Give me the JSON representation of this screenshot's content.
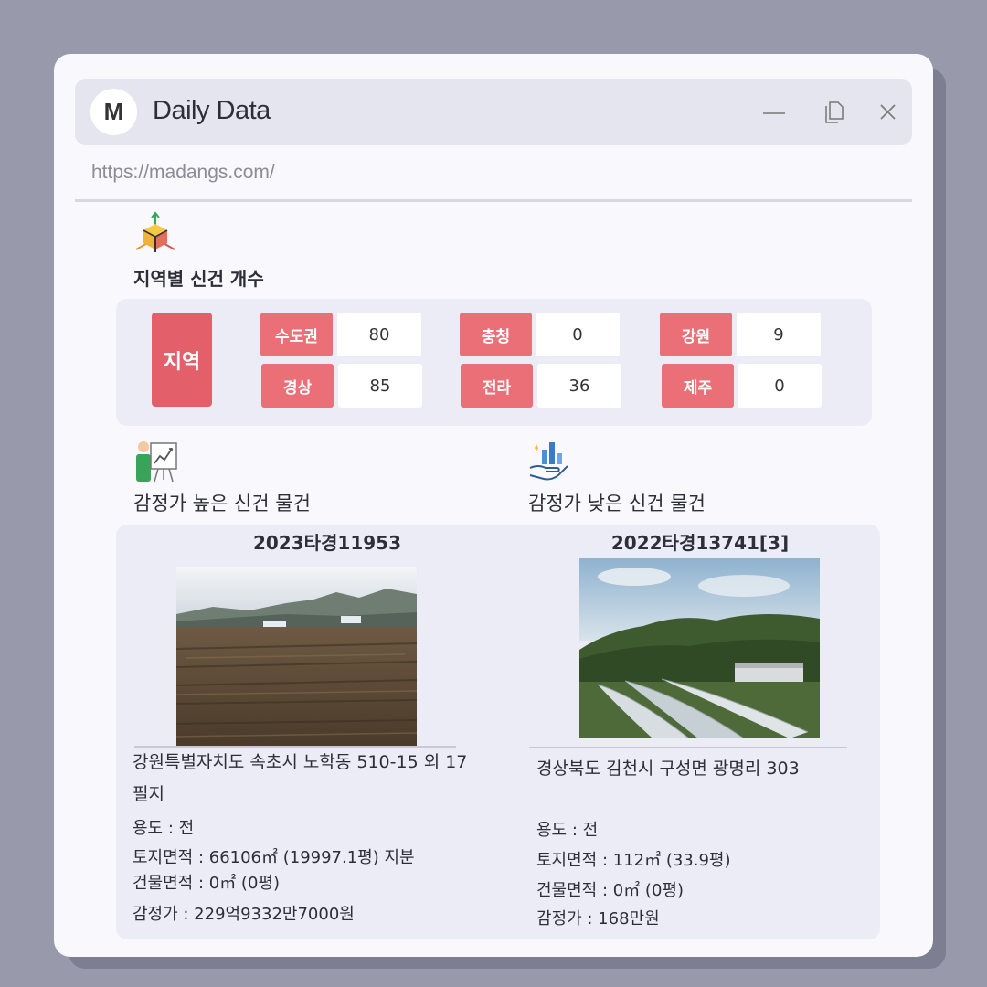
{
  "app": {
    "logo_letter": "M",
    "title": "Daily Data",
    "url": "https://madangs.com/"
  },
  "region_section": {
    "title": "지역별 신건 개수",
    "main_label": "지역",
    "regions": [
      {
        "name": "수도권",
        "count": "80"
      },
      {
        "name": "경상",
        "count": "85"
      },
      {
        "name": "충청",
        "count": "0"
      },
      {
        "name": "전라",
        "count": "36"
      },
      {
        "name": "강원",
        "count": "9"
      },
      {
        "name": "제주",
        "count": "0"
      }
    ]
  },
  "high": {
    "title": "감정가 높은 신건 물건",
    "case_no": "2023타경11953",
    "address": "강원특별자치도 속초시 노학동 510-15 외 17 필지",
    "usage": "용도 : 전",
    "land_area": "토지면적 : 66106㎡ (19997.1평) 지분",
    "building_area": "건물면적 : 0㎡ (0평)",
    "appraisal": "감정가 : 229억9332만7000원"
  },
  "low": {
    "title": "감정가 낮은 신건 물건",
    "case_no": "2022타경13741[3]",
    "address": "경상북도 김천시 구성면 광명리 303",
    "usage": "용도 : 전",
    "land_area": "토지면적 : 112㎡ (33.9평)",
    "building_area": "건물면적 : 0㎡ (0평)",
    "appraisal": "감정가 : 168만원"
  },
  "colors": {
    "accent_red": "#e3606b",
    "tag_red": "#eb6f76",
    "panel": "#ececf6"
  },
  "icons": {
    "window": [
      "minimize-icon",
      "restore-icon",
      "close-icon"
    ],
    "sections": [
      "axis-cube-icon",
      "presentation-chart-icon",
      "hand-chart-icon"
    ]
  }
}
